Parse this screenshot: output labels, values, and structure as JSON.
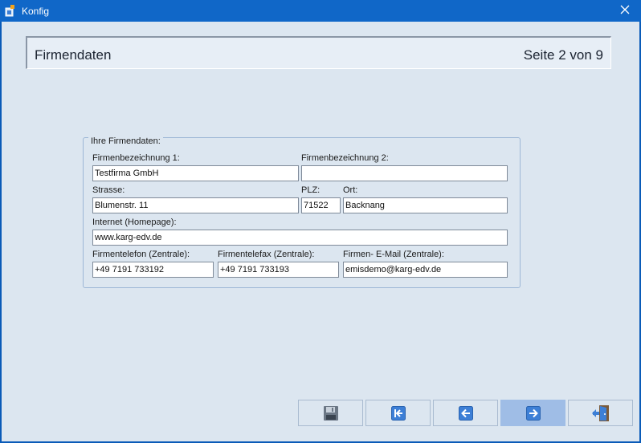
{
  "window": {
    "title": "Konfig",
    "close_icon": "close-icon"
  },
  "header": {
    "title": "Firmendaten",
    "page_counter": "Seite 2 von 9"
  },
  "form": {
    "group_label": "Ihre Firmendaten:",
    "fields": {
      "firmenbezeichnung1": {
        "label": "Firmenbezeichnung 1:",
        "value": "Testfirma GmbH"
      },
      "firmenbezeichnung2": {
        "label": "Firmenbezeichnung 2:",
        "value": ""
      },
      "strasse": {
        "label": "Strasse:",
        "value": "Blumenstr. 11"
      },
      "plz": {
        "label": "PLZ:",
        "value": "71522"
      },
      "ort": {
        "label": "Ort:",
        "value": "Backnang"
      },
      "internet": {
        "label": "Internet (Homepage):",
        "value": "www.karg-edv.de"
      },
      "telefon": {
        "label": "Firmentelefon (Zentrale):",
        "value": "+49 7191 733192"
      },
      "telefax": {
        "label": "Firmentelefax (Zentrale):",
        "value": "+49 7191 733193"
      },
      "email": {
        "label": "Firmen- E-Mail (Zentrale):",
        "value": "emisdemo@karg-edv.de"
      }
    }
  },
  "toolbar": {
    "buttons": [
      {
        "name": "save-button",
        "icon": "floppy-disk-icon"
      },
      {
        "name": "first-page-button",
        "icon": "first-page-icon"
      },
      {
        "name": "previous-page-button",
        "icon": "arrow-left-icon"
      },
      {
        "name": "next-page-button",
        "icon": "arrow-right-icon",
        "state": "highlighted"
      },
      {
        "name": "exit-button",
        "icon": "exit-door-icon"
      }
    ]
  },
  "colors": {
    "titlebar": "#1067c8",
    "background": "#dce6f0",
    "active_button": "#9fbde6",
    "icon_blue": "#3d7fd6"
  }
}
